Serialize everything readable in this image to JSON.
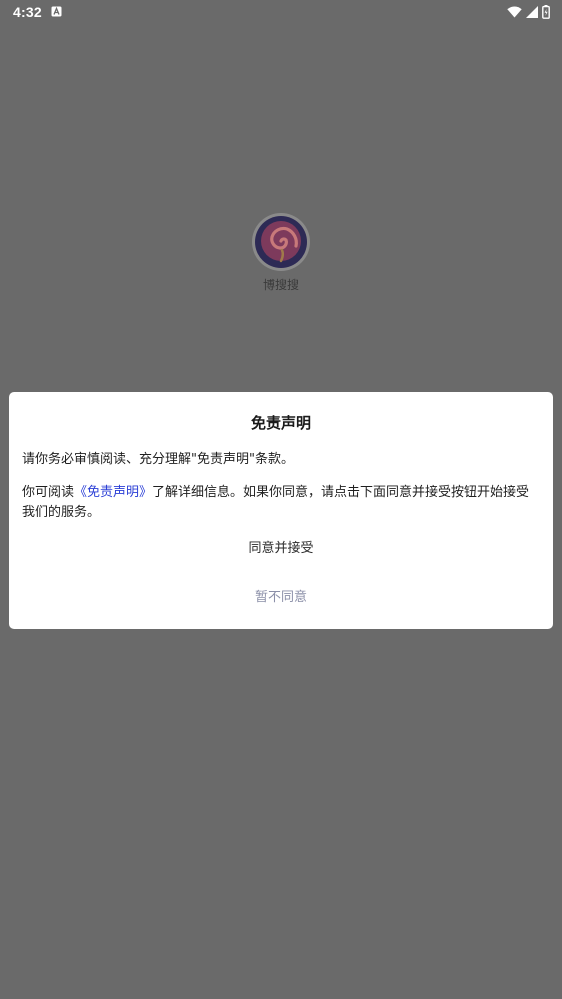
{
  "status_bar": {
    "time": "4:32",
    "icons": [
      "notification-a-icon",
      "wifi-icon",
      "cell-signal-icon",
      "battery-icon"
    ]
  },
  "app": {
    "name": "博搜搜"
  },
  "dialog": {
    "title": "免责声明",
    "paragraph1": "请你务必审慎阅读、充分理解\"免责声明\"条款。",
    "paragraph2_prefix": "你可阅读",
    "paragraph2_link": "《免责声明》",
    "paragraph2_suffix": "了解详细信息。如果你同意，请点击下面同意并接受按钮开始接受我们的服务。",
    "accept_label": "同意并接受",
    "decline_label": "暂不同意"
  },
  "colors": {
    "scrim": "#6a6a6a",
    "dialog_bg": "#ffffff",
    "link": "#2b3fd6",
    "decline_text": "#8b8fa8"
  }
}
